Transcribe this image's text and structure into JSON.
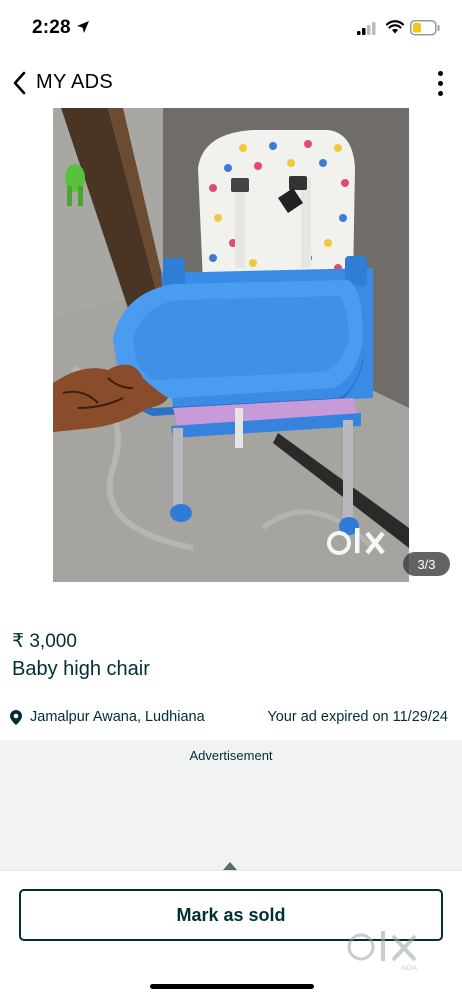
{
  "status_bar": {
    "time": "2:28",
    "icons": [
      "location-arrow-icon",
      "cellular-signal-icon",
      "wifi-icon",
      "battery-icon"
    ],
    "battery_color": "#f5c518"
  },
  "header": {
    "title": "MY ADS",
    "back_icon": "chevron-left-icon",
    "menu_icon": "more-vertical-icon"
  },
  "gallery": {
    "counter": "3/3",
    "watermark": "olx",
    "image_subject": "blue baby high chair with polka dot seat cushion"
  },
  "listing": {
    "price": "₹ 3,000",
    "title": "Baby high chair",
    "location": "Jamalpur Awana, Ludhiana",
    "status": "Your ad expired on 11/29/24"
  },
  "advertisement": {
    "label": "Advertisement"
  },
  "actions": {
    "mark_as_sold": "Mark as sold"
  },
  "watermark": {
    "text": "olx",
    "subtext": "INDIA"
  },
  "colors": {
    "brand_text": "#002f34",
    "chair_blue": "#3d8fe8",
    "ad_background": "#f0f2f3"
  }
}
